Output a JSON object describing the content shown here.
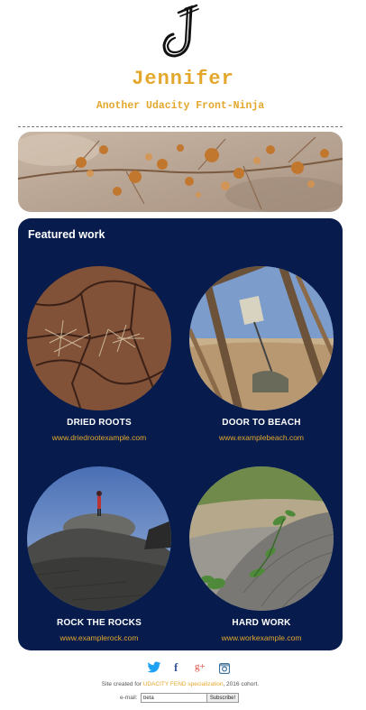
{
  "header": {
    "name": "Jennifer",
    "tagline": "Another Udacity Front-Ninja",
    "logo_icon": "handwritten-j-logo"
  },
  "featured": {
    "title": "Featured work",
    "projects": [
      {
        "title": "DRIED ROOTS",
        "link": "www.driedrootexample.com",
        "image": "cracked-earth-image"
      },
      {
        "title": "DOOR TO BEACH",
        "link": "www.examplebeach.com",
        "image": "door-frame-beach-image"
      },
      {
        "title": "ROCK THE ROCKS",
        "link": "www.examplerock.com",
        "image": "person-on-rock-image"
      },
      {
        "title": "HARD WORK",
        "link": "www.workexample.com",
        "image": "plant-sprout-image"
      }
    ]
  },
  "footer": {
    "social": [
      {
        "name": "twitter-icon",
        "glyph": "🐦",
        "color": "#1da1f2"
      },
      {
        "name": "facebook-icon",
        "glyph": "f",
        "color": "#3b5998"
      },
      {
        "name": "google-plus-icon",
        "glyph": "g+",
        "color": "#dd4b39"
      },
      {
        "name": "instagram-icon",
        "glyph": "◙",
        "color": "#3f729b"
      }
    ],
    "credit_prefix": "Site created for",
    "credit_link": "UDACITY FEND specialization",
    "credit_suffix": ", 2016 cohort.",
    "email_label": "e-mail:",
    "email_value": "beta",
    "subscribe_label": "Subscribe!"
  },
  "colors": {
    "accent": "#e3a72c",
    "panel": "#071c4d"
  }
}
